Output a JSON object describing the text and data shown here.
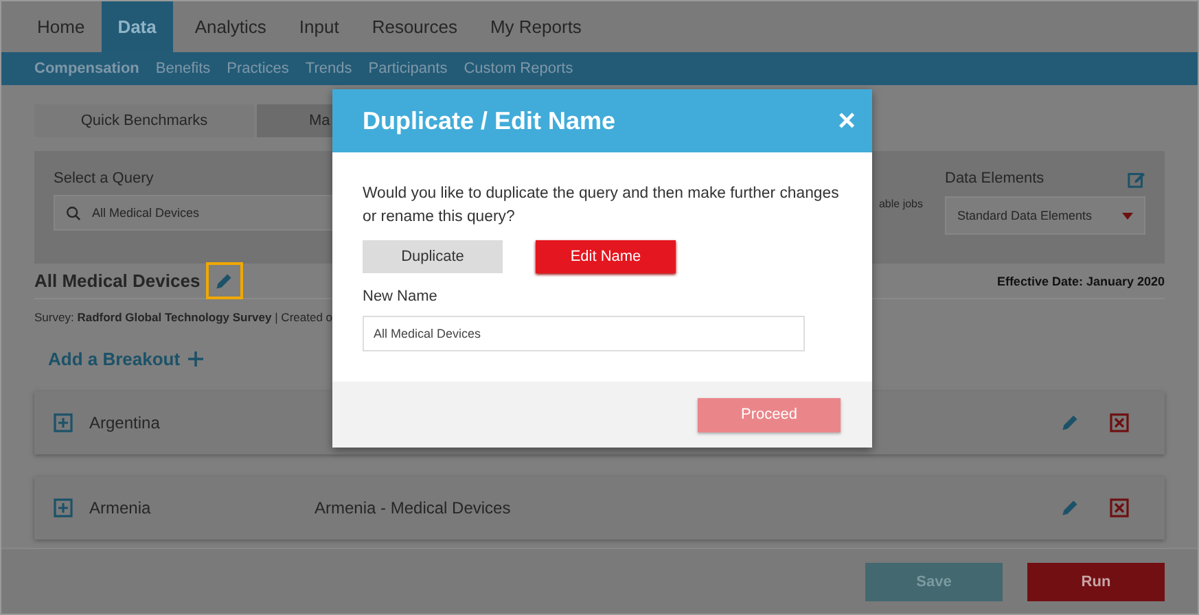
{
  "nav": [
    {
      "label": "Home",
      "selected": false
    },
    {
      "label": "Data",
      "selected": true
    },
    {
      "label": "Analytics",
      "selected": false
    },
    {
      "label": "Input",
      "selected": false
    },
    {
      "label": "Resources",
      "selected": false
    },
    {
      "label": "My Reports",
      "selected": false
    }
  ],
  "subnav": [
    {
      "label": "Compensation",
      "selected": true
    },
    {
      "label": "Benefits",
      "selected": false
    },
    {
      "label": "Practices",
      "selected": false
    },
    {
      "label": "Trends",
      "selected": false
    },
    {
      "label": "Participants",
      "selected": false
    },
    {
      "label": "Custom Reports",
      "selected": false
    }
  ],
  "mode_tabs": [
    {
      "label": "Quick Benchmarks",
      "selected": false
    },
    {
      "label": "Ma",
      "selected": true
    }
  ],
  "query": {
    "label": "Select a Query",
    "value": "All Medical Devices",
    "partial_note": "able jobs",
    "data_elements_label": "Data Elements",
    "data_elements_value": "Standard Data Elements"
  },
  "query_title": "All Medical Devices",
  "effective_date": "Effective Date: January 2020",
  "survey_line": {
    "prefix": "Survey:",
    "survey": "Radford Global Technology Survey",
    "suffix": "| Created o"
  },
  "add_breakout": "Add a Breakout",
  "breakouts": [
    {
      "name": "Argentina"
    },
    {
      "name": "Armenia",
      "description": "Armenia - Medical Devices"
    }
  ],
  "footer_buttons": [
    {
      "label": "Save",
      "kind": "secondary"
    },
    {
      "label": "Run",
      "kind": "primary"
    }
  ],
  "dialog": {
    "title": "Duplicate / Edit Name",
    "close": "×",
    "message": "Would you like to duplicate the query and then make further changes or rename this query?",
    "options": [
      {
        "label": "Duplicate",
        "selected": false
      },
      {
        "label": "Edit Name",
        "selected": true
      }
    ],
    "field_label": "New Name",
    "field_value": "All Medical Devices",
    "proceed": "Proceed"
  }
}
